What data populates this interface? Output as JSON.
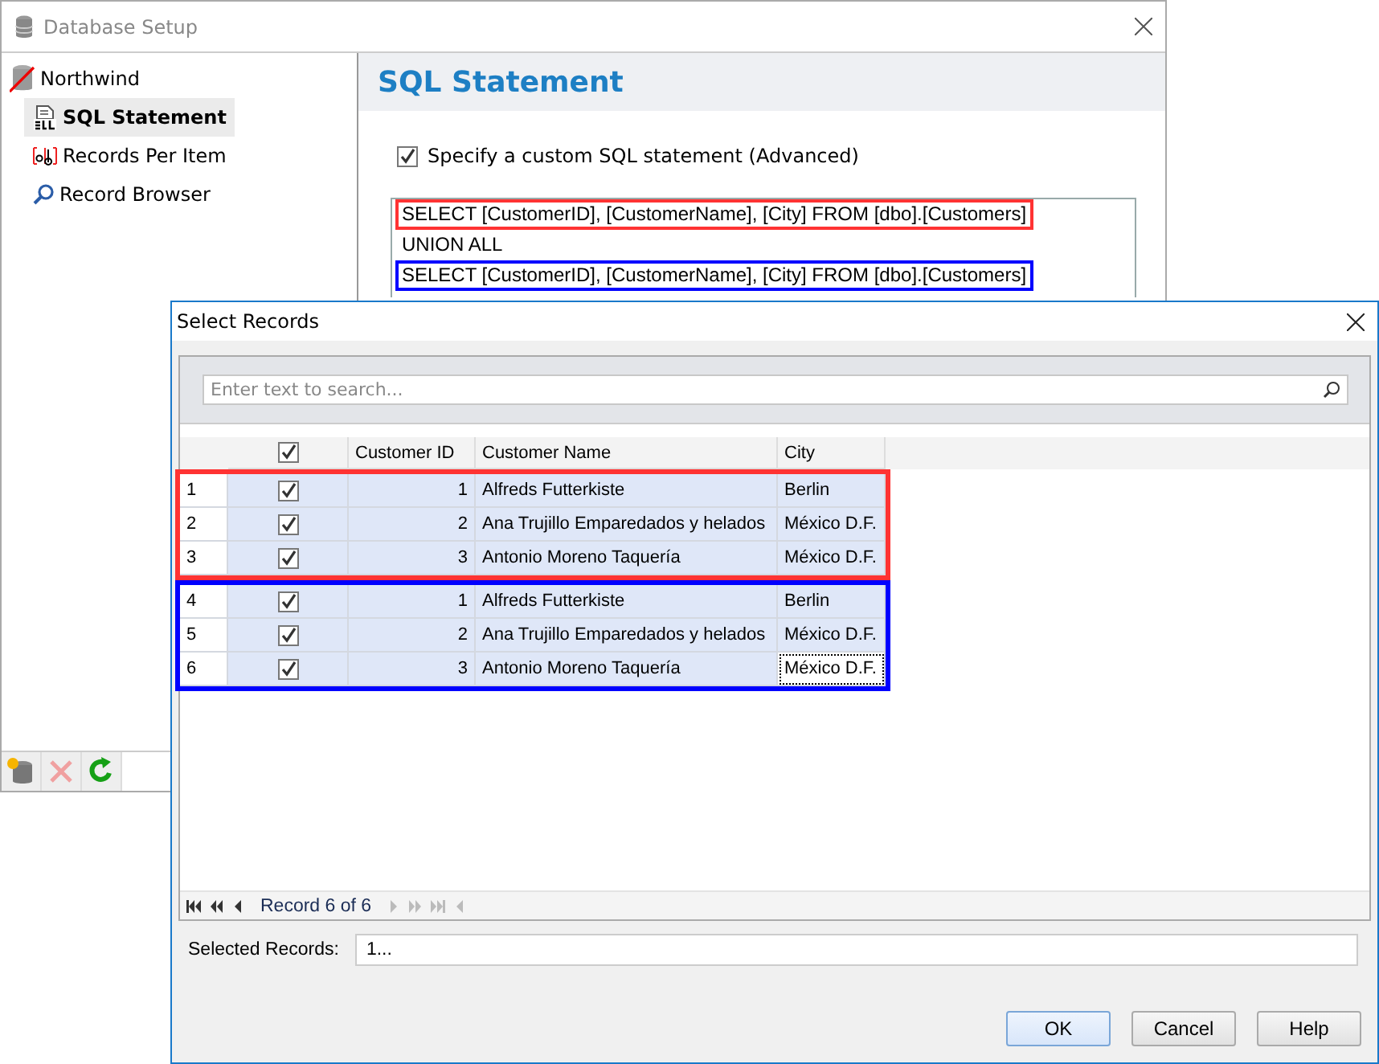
{
  "back_window": {
    "title": "Database Setup",
    "tree": [
      {
        "label": "Northwind",
        "selected": false,
        "children": [
          {
            "label": "SQL Statement",
            "selected": true,
            "kind": "sql"
          },
          {
            "label": "Records Per Item",
            "selected": false,
            "kind": "ab"
          },
          {
            "label": "Record Browser",
            "selected": false,
            "kind": "search"
          }
        ]
      }
    ],
    "heading": "SQL Statement",
    "custom_sql": {
      "label": "Specify a custom SQL statement (Advanced)",
      "checked": true
    },
    "sql_lines": [
      {
        "text": "SELECT [CustomerID], [CustomerName], [City] FROM [dbo].[Customers]",
        "color": "#ff3333"
      },
      {
        "text": "UNION ALL"
      },
      {
        "text": "SELECT [CustomerID], [CustomerName], [City] FROM [dbo].[Customers]",
        "color": "#0000ff"
      }
    ]
  },
  "front_window": {
    "title": "Select Records",
    "search": {
      "placeholder": "Enter text to search..."
    },
    "columns": [
      "Customer ID",
      "Customer Name",
      "City"
    ],
    "header_checked": true,
    "row_groups": [
      {
        "color": "#ff3333",
        "rows": [
          {
            "number": "1",
            "checked": true,
            "selected": true,
            "focused": false,
            "id": "1",
            "name": "Alfreds Futterkiste",
            "city": "Berlin"
          },
          {
            "number": "2",
            "checked": true,
            "selected": true,
            "focused": false,
            "id": "2",
            "name": "Ana Trujillo Emparedados y helados",
            "city": "México D.F."
          },
          {
            "number": "3",
            "checked": true,
            "selected": true,
            "focused": false,
            "id": "3",
            "name": "Antonio Moreno Taquería",
            "city": "México D.F."
          }
        ]
      },
      {
        "color": "#0000ff",
        "rows": [
          {
            "number": "4",
            "checked": true,
            "selected": true,
            "focused": false,
            "id": "1",
            "name": "Alfreds Futterkiste",
            "city": "Berlin"
          },
          {
            "number": "5",
            "checked": true,
            "selected": true,
            "focused": false,
            "id": "2",
            "name": "Ana Trujillo Emparedados y helados",
            "city": "México D.F."
          },
          {
            "number": "6",
            "checked": true,
            "selected": true,
            "focused": true,
            "id": "3",
            "name": "Antonio Moreno Taquería",
            "city": "México D.F."
          }
        ]
      }
    ],
    "navigator": "Record 6 of 6",
    "selected_records": {
      "label": "Selected Records:",
      "value": "1..."
    },
    "buttons": [
      {
        "label": "OK",
        "default": true
      },
      {
        "label": "Cancel",
        "default": false
      },
      {
        "label": "Help",
        "default": false
      }
    ]
  }
}
